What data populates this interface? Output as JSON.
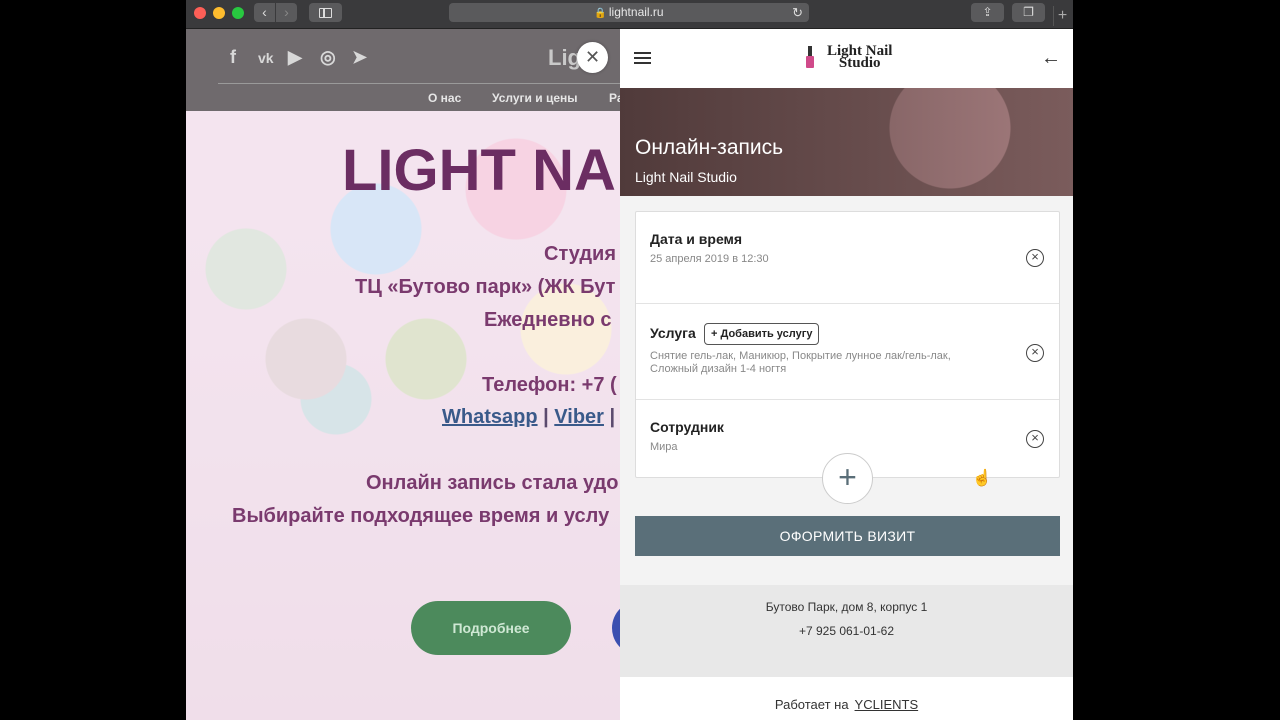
{
  "browser": {
    "url": "lightnail.ru",
    "back": "‹",
    "forward": "›",
    "lock": "🔒",
    "reload": "↻",
    "share": "⇪",
    "tabs": "❐",
    "new_tab": "+"
  },
  "site": {
    "social": [
      "f",
      "vk",
      "▶",
      "◎",
      "➤"
    ],
    "logo_text": "Lig",
    "menu": [
      "О нас",
      "Услуги и цены",
      "Ра"
    ],
    "title": "LIGHT NA",
    "lines": [
      "Студия",
      "ТЦ «Бутово парк» (ЖК Бут",
      "Ежедневно с",
      "Телефон: +7 (",
      "Онлайн запись стала удо",
      "Выбирайте подходящее время и услу"
    ],
    "links": [
      "Whatsapp",
      "Viber"
    ],
    "link_sep": "|",
    "more_button": "Подробнее"
  },
  "overlay": {
    "close": "✕"
  },
  "widget": {
    "logo": {
      "line1": "Light Nail",
      "line2": "Studio"
    },
    "back_icon": "←",
    "hero": {
      "title": "Онлайн-запись",
      "subtitle": "Light Nail Studio"
    },
    "rows": {
      "datetime": {
        "title": "Дата и время",
        "value": "25 апреля 2019 в 12:30"
      },
      "service": {
        "title": "Услуга",
        "add_label": "+ Добавить услугу",
        "value": "Снятие гель-лак, Маникюр, Покрытие лунное лак/гель-лак, Сложный дизайн 1-4 ногтя"
      },
      "staff": {
        "title": "Сотрудник",
        "value": "Мира"
      }
    },
    "remove_icon": "×",
    "plus_icon": "+",
    "submit_label": "ОФОРМИТЬ ВИЗИТ",
    "address": "Бутово Парк, дом 8, корпус 1",
    "phone": "+7 925 061-01-62",
    "powered_by": "Работает на",
    "powered_link": "YCLIENTS"
  }
}
